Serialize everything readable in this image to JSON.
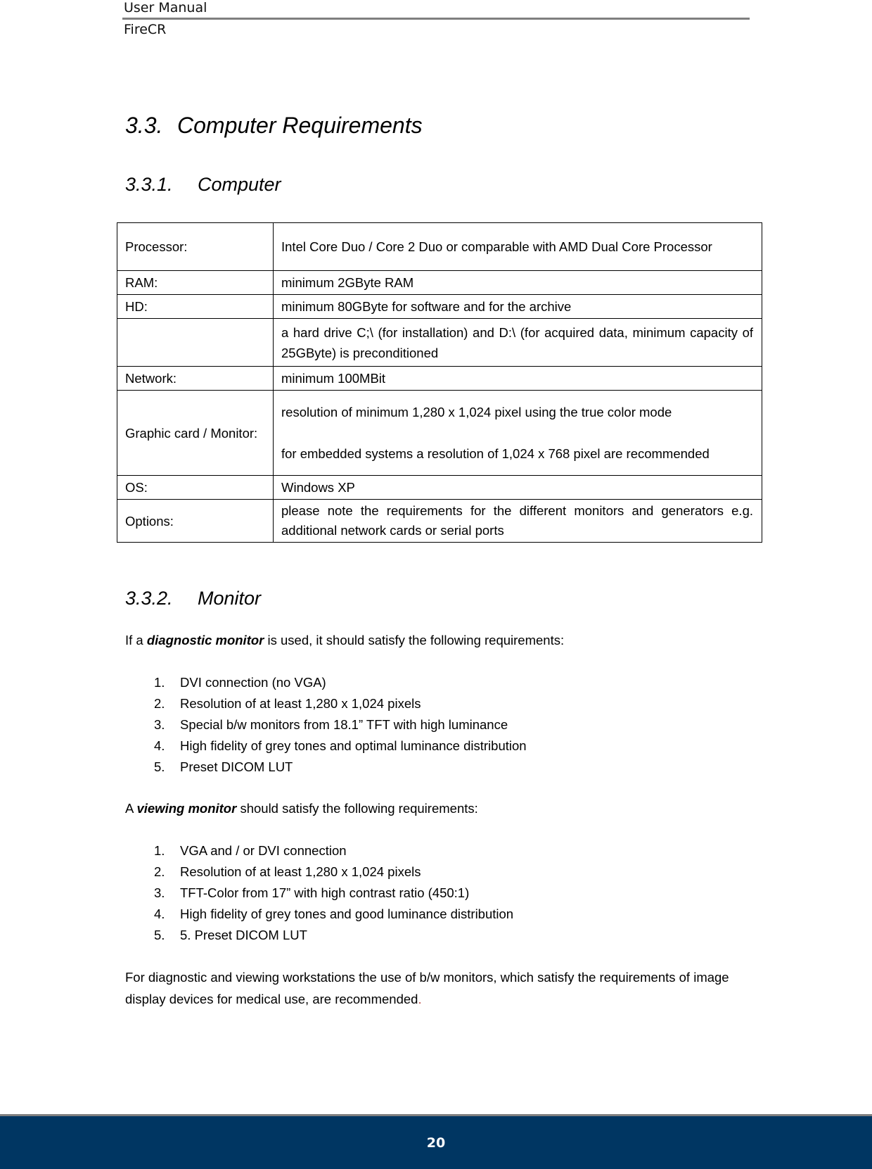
{
  "header": {
    "doc_type": "User Manual",
    "product": "FireCR"
  },
  "section": {
    "number": "3.3.",
    "title": "Computer Requirements"
  },
  "computer": {
    "number": "3.3.1.",
    "title": "Computer",
    "rows": [
      {
        "key": "Processor:",
        "value": "Intel Core Duo / Core 2 Duo or comparable with AMD Dual Core Processor"
      },
      {
        "key": "RAM:",
        "value": "minimum 2GByte RAM"
      },
      {
        "key": "HD:",
        "value": "minimum 80GByte for software and for the archive"
      },
      {
        "key": "",
        "value": "a hard drive C;\\ (for installation) and D:\\ (for acquired data, minimum capacity of 25GByte) is preconditioned"
      },
      {
        "key": "Network:",
        "value": "minimum 100MBit"
      },
      {
        "key": "Graphic card / Monitor:",
        "value": "resolution of minimum 1,280 x 1,024 pixel using the true color mode",
        "value2": "for embedded systems a resolution of 1,024 x 768 pixel are recommended"
      },
      {
        "key": "OS:",
        "value": "Windows XP"
      },
      {
        "key": "Options:",
        "value": "please note the requirements for the different monitors and generators e.g. additional network cards or serial ports"
      }
    ]
  },
  "monitor": {
    "number": "3.3.2.",
    "title": "Monitor",
    "diagnostic_intro": {
      "pre": "If a ",
      "em": "diagnostic monitor",
      "post": " is used, it should satisfy the following requirements:"
    },
    "diagnostic_items": [
      "DVI connection (no VGA)",
      "Resolution of at least 1,280 x 1,024 pixels",
      "Special b/w monitors from 18.1” TFT with high luminance",
      "High fidelity of grey tones and optimal luminance distribution",
      "Preset DICOM LUT"
    ],
    "viewing_intro": {
      "pre": "A ",
      "em": "viewing monitor",
      "post": " should satisfy the following requirements:"
    },
    "viewing_items": [
      "VGA and / or DVI connection",
      "Resolution of at least 1,280 x 1,024 pixels",
      "TFT-Color from 17” with high contrast ratio (450:1)",
      "High fidelity of grey tones and good luminance distribution",
      "5. Preset DICOM LUT"
    ],
    "closing": "For diagnostic and viewing workstations the use of b/w monitors, which satisfy the requirements of image display devices for medical use, are recommended",
    "closing_end": "."
  },
  "footer": {
    "page_number": "20"
  },
  "colors": {
    "footer_bg": "#003662",
    "rule": "#7f7f7f"
  }
}
